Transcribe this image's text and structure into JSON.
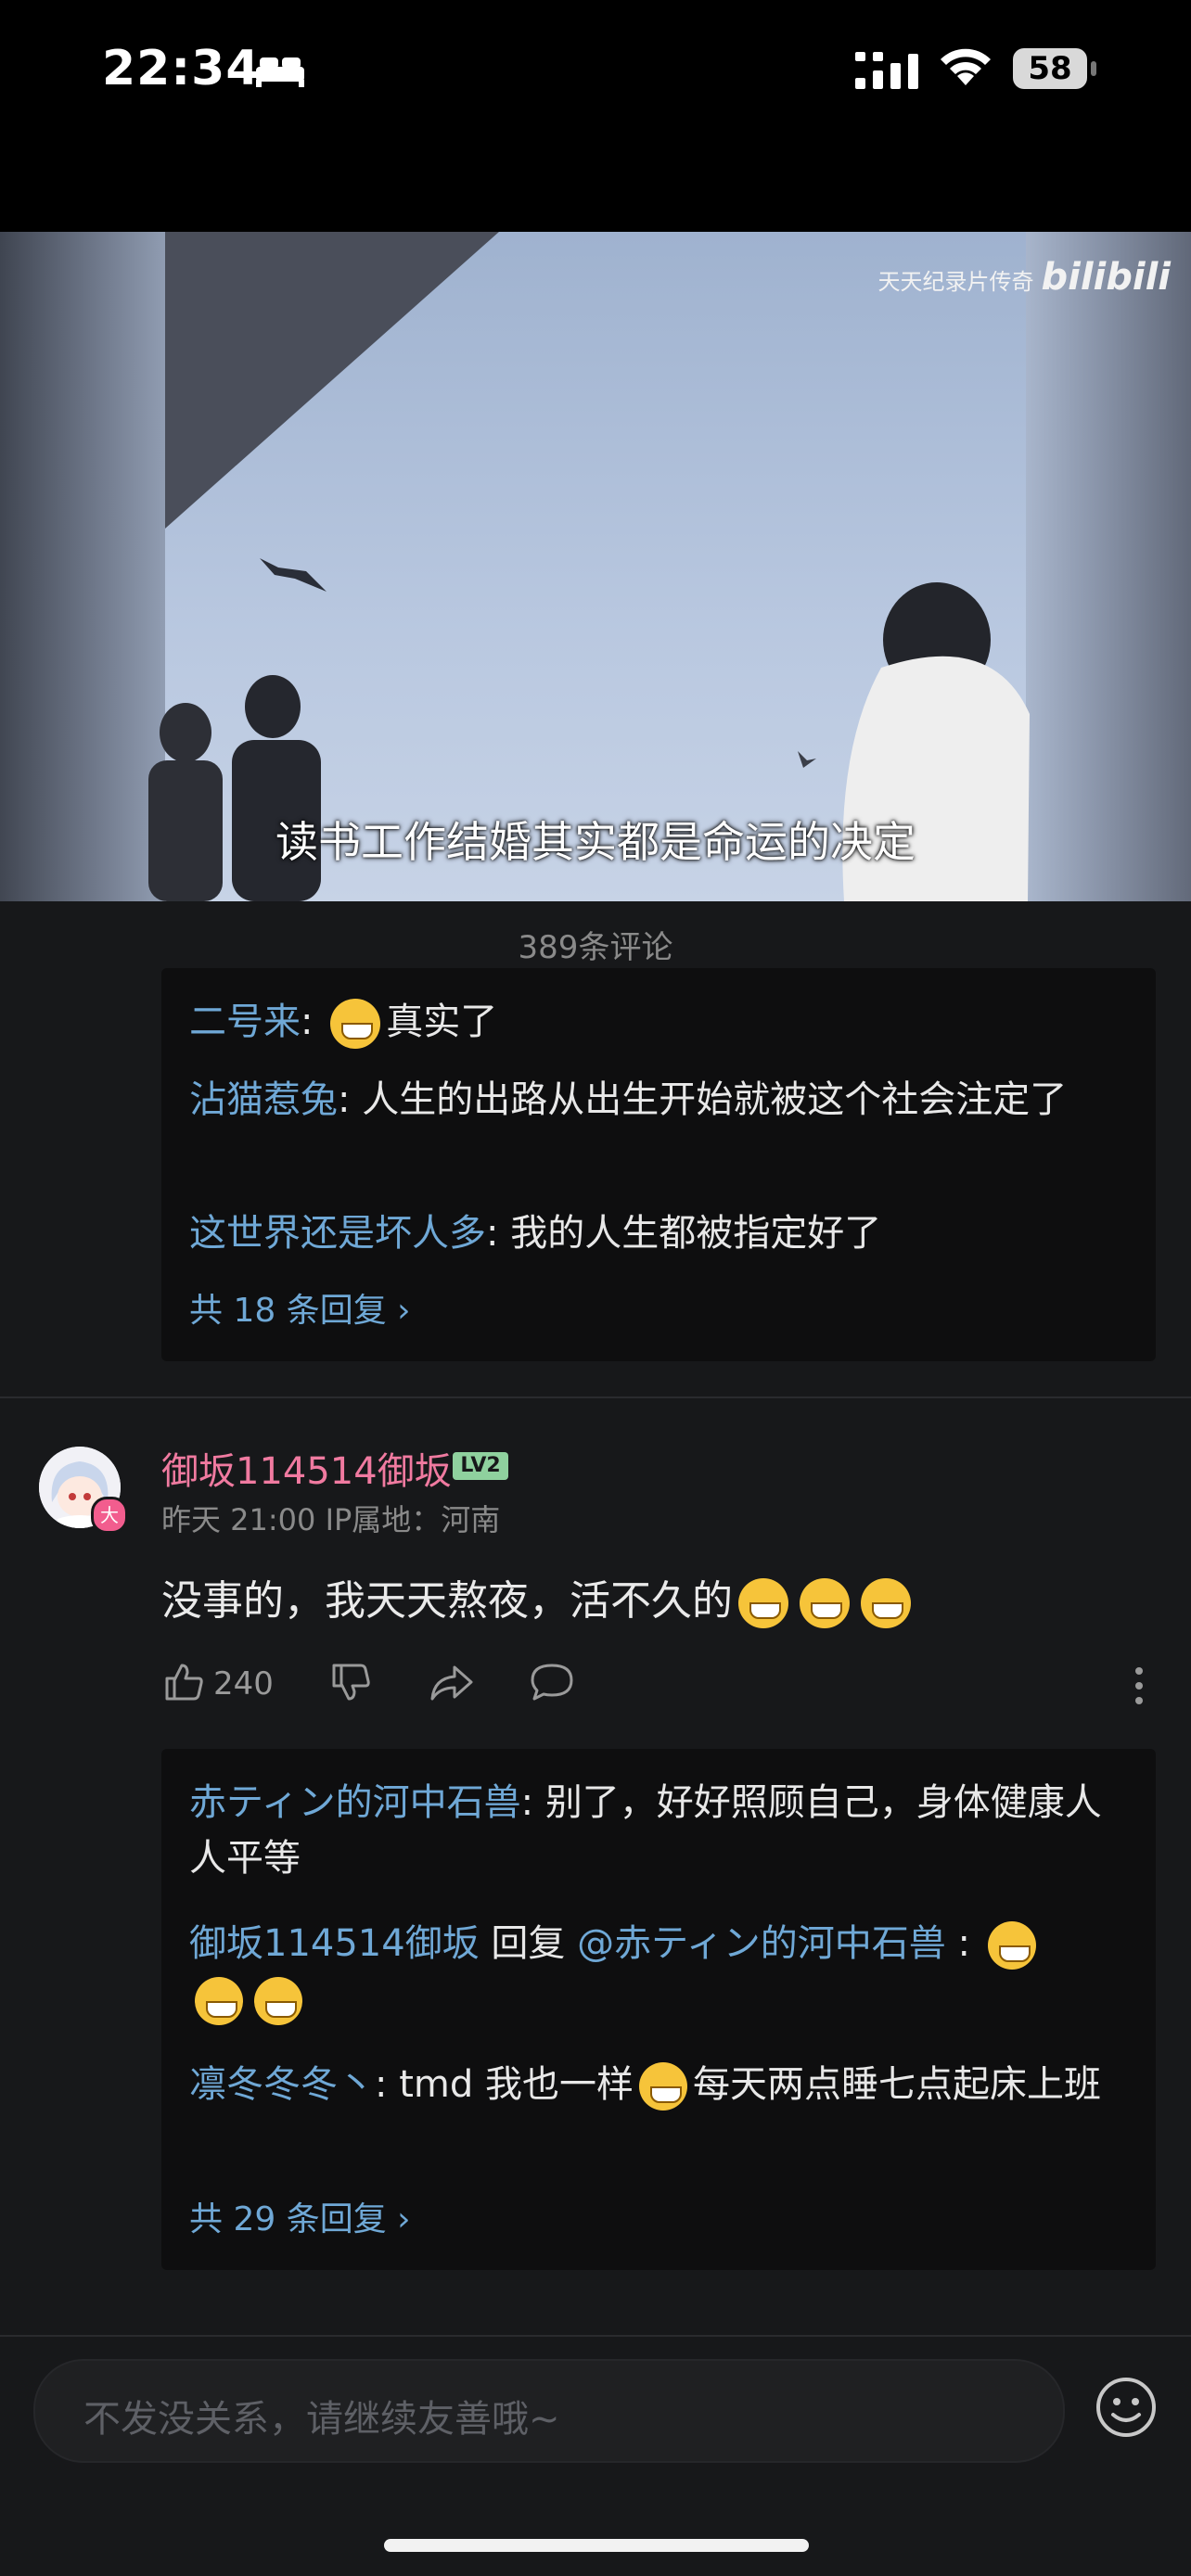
{
  "status_bar": {
    "time": "22:34",
    "battery": "58"
  },
  "video": {
    "watermark": "天天纪录片传奇",
    "watermark_logo": "bilibili",
    "subtitle": "读书工作结婚其实都是命运的决定"
  },
  "comment_count": "389条评论",
  "thread1": {
    "replies": [
      {
        "user": "二号来",
        "sep": ": ",
        "text": "真实了",
        "emoji": "laugh-cry-icon"
      },
      {
        "user": "沾猫惹兔",
        "sep": ": ",
        "text": "人生的出路从出生开始就被这个社会注定了"
      },
      {
        "user": "这世界还是坏人多",
        "sep": ": ",
        "text": "我的人生都被指定好了"
      }
    ],
    "more": "共 18 条回复 ›"
  },
  "comment": {
    "username": "御坂114514御坂",
    "level": "LV2",
    "avatar_badge": "大",
    "meta": "昨天 21:00  IP属地：河南",
    "text": "没事的，我天天熬夜，活不久的",
    "likes": "240",
    "replies": [
      {
        "user": "赤ティン的河中石兽",
        "sep": ": ",
        "text": "别了，好好照顾自己，身体健康人人平等"
      },
      {
        "user": "御坂114514御坂",
        "mid": " 回复 ",
        "mention": "@赤ティン的河中石兽",
        "sep": " : "
      },
      {
        "user": "凛冬冬冬丶",
        "sep": ": ",
        "text_a": "tmd 我也一样",
        "text_b": "每天两点睡七点起床上班"
      }
    ],
    "more": "共 29 条回复 ›"
  },
  "input": {
    "placeholder": "不发没关系，请继续友善哦~"
  },
  "colors": {
    "background": "#17181a",
    "username": "#6fa8d6",
    "pink_name": "#f07aa0",
    "level_badge": "#8fd19e"
  }
}
